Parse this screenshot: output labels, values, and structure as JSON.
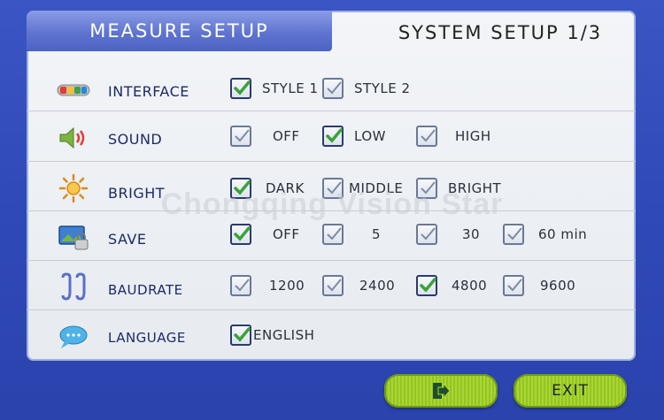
{
  "tabs": {
    "measure_setup": "MEASURE SETUP",
    "system_setup": "SYSTEM SETUP 1/3"
  },
  "watermark": "Chongqing Vision Star",
  "rows": [
    {
      "label": "INTERFACE",
      "icon": "battery-bars-icon",
      "options": [
        {
          "label": "STYLE 1",
          "checked": true
        },
        {
          "label": "STYLE 2",
          "checked": false
        }
      ]
    },
    {
      "label": "SOUND",
      "icon": "speaker-icon",
      "options": [
        {
          "label": "OFF",
          "checked": false
        },
        {
          "label": "LOW",
          "checked": true
        },
        {
          "label": "HIGH",
          "checked": false
        }
      ]
    },
    {
      "label": "BRIGHT",
      "icon": "sun-icon",
      "options": [
        {
          "label": "DARK",
          "checked": true
        },
        {
          "label": "MIDDLE",
          "checked": false
        },
        {
          "label": "BRIGHT",
          "checked": false
        }
      ]
    },
    {
      "label": "SAVE",
      "icon": "screen-lock-icon",
      "options": [
        {
          "label": "OFF",
          "checked": true
        },
        {
          "label": "5",
          "checked": false
        },
        {
          "label": "30",
          "checked": false
        },
        {
          "label": "60 min",
          "checked": false
        }
      ]
    },
    {
      "label": "BAUDRATE",
      "icon": "connector-icon",
      "options": [
        {
          "label": "1200",
          "checked": false
        },
        {
          "label": "2400",
          "checked": false
        },
        {
          "label": "4800",
          "checked": true
        },
        {
          "label": "9600",
          "checked": false
        }
      ]
    },
    {
      "label": "LANGUAGE",
      "icon": "speech-bubble-icon",
      "options": [
        {
          "label": "ENGLISH",
          "checked": true
        }
      ]
    }
  ],
  "buttons": {
    "next_icon": "next-page-arrow-icon",
    "exit_label": "EXIT"
  },
  "colors": {
    "check_green": "#3aa23a",
    "background_blue": "#2f49b8",
    "button_green": "#a9d635"
  }
}
